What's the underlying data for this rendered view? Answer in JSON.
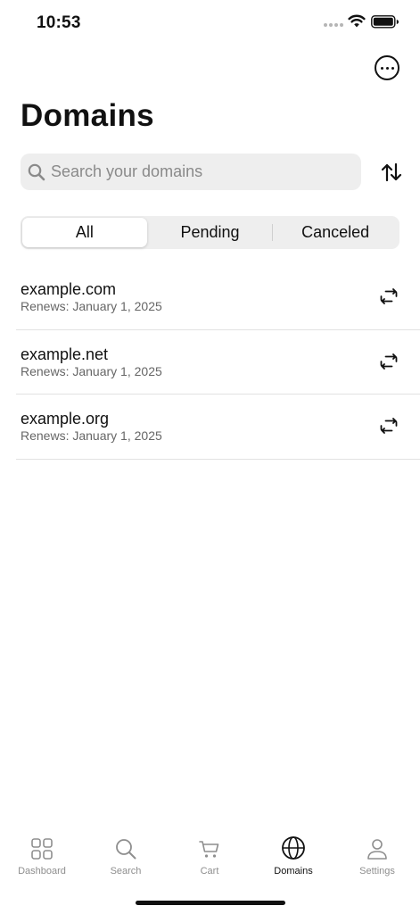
{
  "status_bar": {
    "time": "10:53",
    "icons": [
      "cellular-signal-icon",
      "wifi-icon",
      "battery-icon"
    ]
  },
  "header": {
    "more_icon": "more-horizontal-icon",
    "title": "Domains"
  },
  "search": {
    "placeholder": "Search your domains",
    "value": "",
    "icon": "search-icon"
  },
  "sort": {
    "icon": "sort-arrows-icon"
  },
  "filter_tabs": {
    "selected": "All",
    "items": [
      {
        "label": "All"
      },
      {
        "label": "Pending"
      },
      {
        "label": "Canceled"
      }
    ]
  },
  "domains": [
    {
      "name": "example.com",
      "renewal": "Renews: January 1, 2025",
      "icon": "auto-renew-icon"
    },
    {
      "name": "example.net",
      "renewal": "Renews: January 1, 2025",
      "icon": "auto-renew-icon"
    },
    {
      "name": "example.org",
      "renewal": "Renews: January 1, 2025",
      "icon": "auto-renew-icon"
    }
  ],
  "tab_bar": {
    "selected": "Domains",
    "items": [
      {
        "label": "Dashboard",
        "icon": "grid-icon"
      },
      {
        "label": "Search",
        "icon": "search-icon"
      },
      {
        "label": "Cart",
        "icon": "cart-icon"
      },
      {
        "label": "Domains",
        "icon": "globe-icon"
      },
      {
        "label": "Settings",
        "icon": "person-icon"
      }
    ]
  },
  "colors": {
    "text": "#111111",
    "secondary_text": "#666666",
    "control_background": "#eeeeee",
    "inactive_tab": "#8e8e8e",
    "divider": "#e2e2e2"
  }
}
